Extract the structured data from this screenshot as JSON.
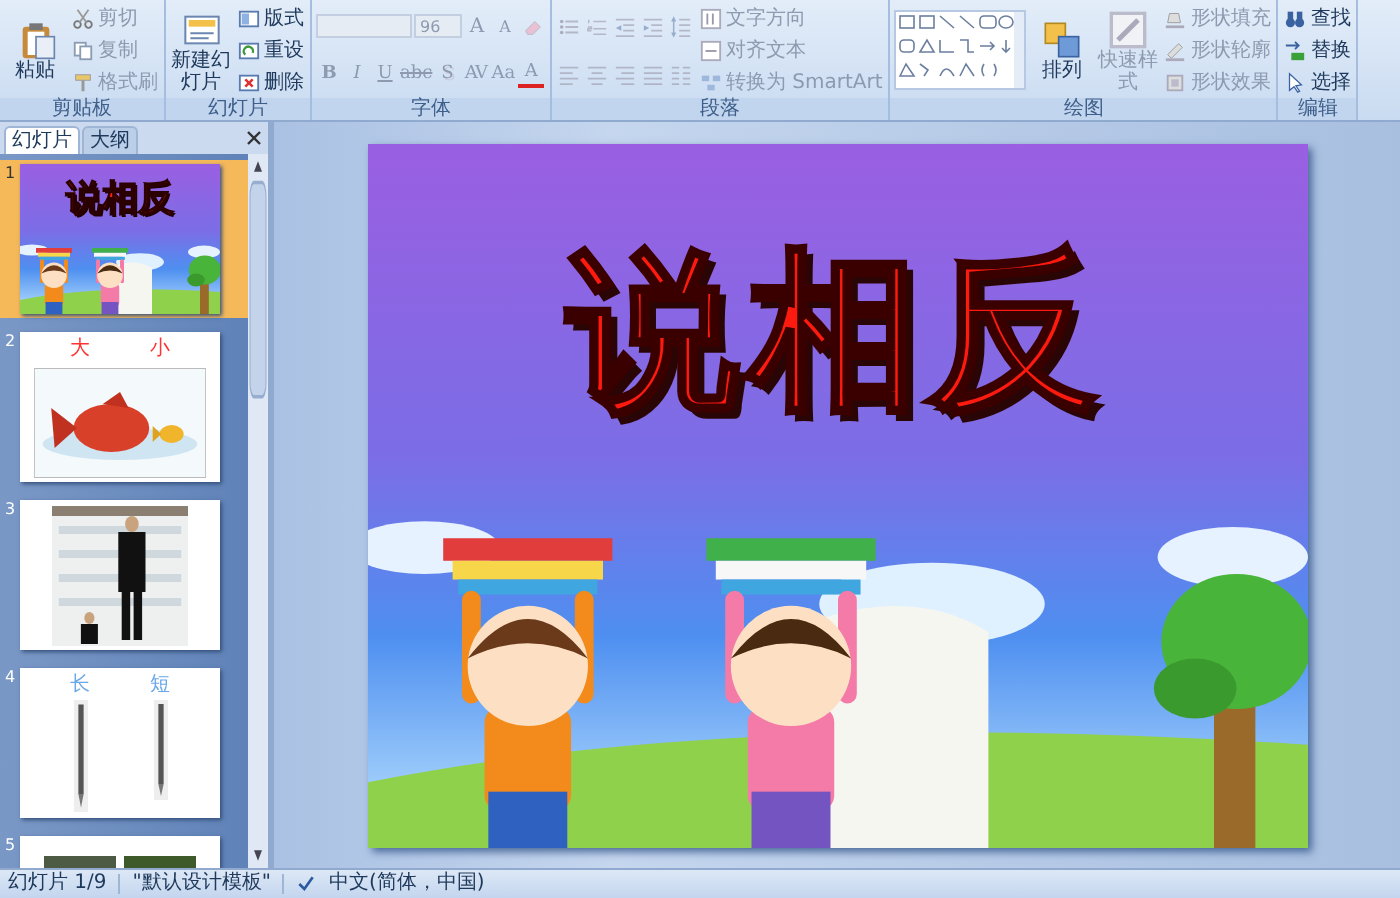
{
  "ribbon": {
    "groups": [
      {
        "label": "剪贴板",
        "columns": [
          [
            {
              "kind": "large",
              "label": "粘贴",
              "disabled": false
            }
          ],
          [
            {
              "kind": "small",
              "label": "剪切",
              "disabled": true
            },
            {
              "kind": "small",
              "label": "复制",
              "disabled": true
            },
            {
              "kind": "small",
              "label": "格式刷",
              "disabled": true
            }
          ]
        ]
      },
      {
        "label": "幻灯片",
        "columns": [
          [
            {
              "kind": "large",
              "label": "新建幻灯片",
              "disabled": false
            }
          ],
          [
            {
              "kind": "small",
              "label": "版式",
              "disabled": false
            },
            {
              "kind": "small",
              "label": "重设",
              "disabled": false
            },
            {
              "kind": "small",
              "label": "删除",
              "disabled": false
            }
          ]
        ]
      },
      {
        "label": "字体",
        "columns": [
          [
            {
              "kind": "row",
              "items": [
                {
                  "kind": "fontfield",
                  "disabled": true
                },
                {
                  "kind": "sizefield",
                  "value": "96",
                  "disabled": true
                },
                {
                  "kind": "glyph",
                  "label": "A",
                  "disabled": true
                },
                {
                  "kind": "glyph",
                  "label": "A",
                  "disabled": true
                },
                {
                  "kind": "icon",
                  "disabled": true
                }
              ]
            },
            {
              "kind": "row",
              "items": [
                {
                  "kind": "glyph",
                  "label": "B",
                  "disabled": true
                },
                {
                  "kind": "glyph",
                  "label": "I",
                  "disabled": true
                },
                {
                  "kind": "glyph",
                  "label": "U",
                  "disabled": true
                },
                {
                  "kind": "glyph",
                  "label": "abc",
                  "disabled": true
                },
                {
                  "kind": "glyph",
                  "label": "S",
                  "disabled": true
                },
                {
                  "kind": "glyph",
                  "label": "AV",
                  "disabled": true
                },
                {
                  "kind": "glyph",
                  "label": "Aa",
                  "disabled": true
                },
                {
                  "kind": "glyph",
                  "label": "A",
                  "disabled": true
                }
              ]
            }
          ]
        ]
      },
      {
        "label": "段落",
        "columns": [
          [
            {
              "kind": "row",
              "items": [
                {
                  "kind": "icon",
                  "disabled": true
                },
                {
                  "kind": "icon",
                  "disabled": true
                },
                {
                  "kind": "icon",
                  "disabled": true
                },
                {
                  "kind": "icon",
                  "disabled": true
                },
                {
                  "kind": "icon",
                  "disabled": true
                }
              ]
            },
            {
              "kind": "row",
              "items": [
                {
                  "kind": "icon",
                  "disabled": true
                },
                {
                  "kind": "icon",
                  "disabled": true
                },
                {
                  "kind": "icon",
                  "disabled": true
                },
                {
                  "kind": "icon",
                  "disabled": true
                },
                {
                  "kind": "icon",
                  "disabled": true
                }
              ]
            }
          ],
          [
            {
              "kind": "small",
              "label": "文字方向",
              "disabled": true
            },
            {
              "kind": "small",
              "label": "对齐文本",
              "disabled": true
            },
            {
              "kind": "small",
              "label": "转换为 SmartArt",
              "disabled": true
            }
          ]
        ]
      },
      {
        "label": "绘图",
        "columns": [
          [
            {
              "kind": "gallery"
            }
          ],
          [
            {
              "kind": "large",
              "label": "排列",
              "disabled": false
            }
          ],
          [
            {
              "kind": "large",
              "label": "快速样式",
              "disabled": true
            }
          ],
          [
            {
              "kind": "small",
              "label": "形状填充",
              "disabled": true
            },
            {
              "kind": "small",
              "label": "形状轮廓",
              "disabled": true
            },
            {
              "kind": "small",
              "label": "形状效果",
              "disabled": true
            }
          ]
        ]
      },
      {
        "label": "编辑",
        "columns": [
          [
            {
              "kind": "small",
              "label": "查找",
              "disabled": false
            },
            {
              "kind": "small",
              "label": "替换",
              "disabled": false
            },
            {
              "kind": "small",
              "label": "选择",
              "disabled": false
            }
          ]
        ]
      }
    ]
  },
  "slides_panel": {
    "tabs": [
      {
        "label": "幻灯片",
        "selected": true
      },
      {
        "label": "大纲",
        "selected": false
      }
    ],
    "slides": [
      {
        "number": "1",
        "selected": true,
        "kind": "title",
        "texts": [
          "说相反"
        ]
      },
      {
        "number": "2",
        "selected": false,
        "kind": "fish",
        "texts": [
          "大",
          "小"
        ]
      },
      {
        "number": "3",
        "selected": false
      },
      {
        "number": "4",
        "selected": false,
        "kind": "pens",
        "texts": [
          "长",
          "短"
        ]
      },
      {
        "number": "5",
        "selected": false,
        "kind": "partial"
      }
    ]
  },
  "slide": {
    "title": "说相反"
  },
  "status_bar": {
    "slide_count": "幻灯片 1/9",
    "theme": "\"默认设计模板\"",
    "language": "中文(简体，中国)"
  }
}
